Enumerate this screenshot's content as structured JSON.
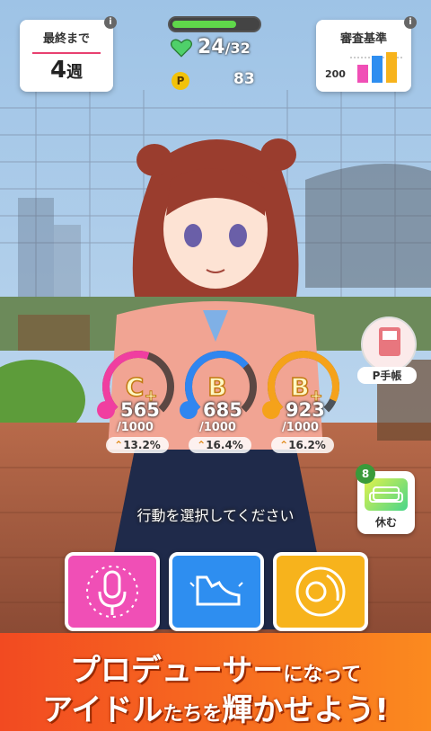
{
  "weeks": {
    "label": "最終まで",
    "value": "4",
    "unit": "週"
  },
  "stamina": {
    "current": "24",
    "max": "32",
    "fraction": 0.75
  },
  "p_points": {
    "icon": "P",
    "value": "83"
  },
  "criteria": {
    "label": "審査基準",
    "threshold": "200"
  },
  "p_notebook": {
    "label": "P手帳"
  },
  "rest": {
    "label": "休む",
    "badge": "8"
  },
  "stats": [
    {
      "grade": "C",
      "plus": "+",
      "score": "565",
      "max": "/1000",
      "percent": "13.2%",
      "color": "#f03ea0",
      "level": 0.565
    },
    {
      "grade": "B",
      "plus": "",
      "score": "685",
      "max": "/1000",
      "percent": "16.4%",
      "color": "#2f86f0",
      "level": 0.685
    },
    {
      "grade": "B",
      "plus": "+",
      "score": "923",
      "max": "/1000",
      "percent": "16.2%",
      "color": "#f5a21a",
      "level": 0.923
    }
  ],
  "prompt": "行動を選択してください",
  "actions": [
    {
      "name": "vocal",
      "color": "#f04fb6"
    },
    {
      "name": "dance",
      "color": "#2e8ef0"
    },
    {
      "name": "visual",
      "color": "#f7b31c"
    }
  ],
  "banner": {
    "l1_a": "プロデューサー",
    "l1_b": "になって",
    "l2_a": "アイドル",
    "l2_b": "たちを",
    "l2_c": "輝かせよう!"
  }
}
